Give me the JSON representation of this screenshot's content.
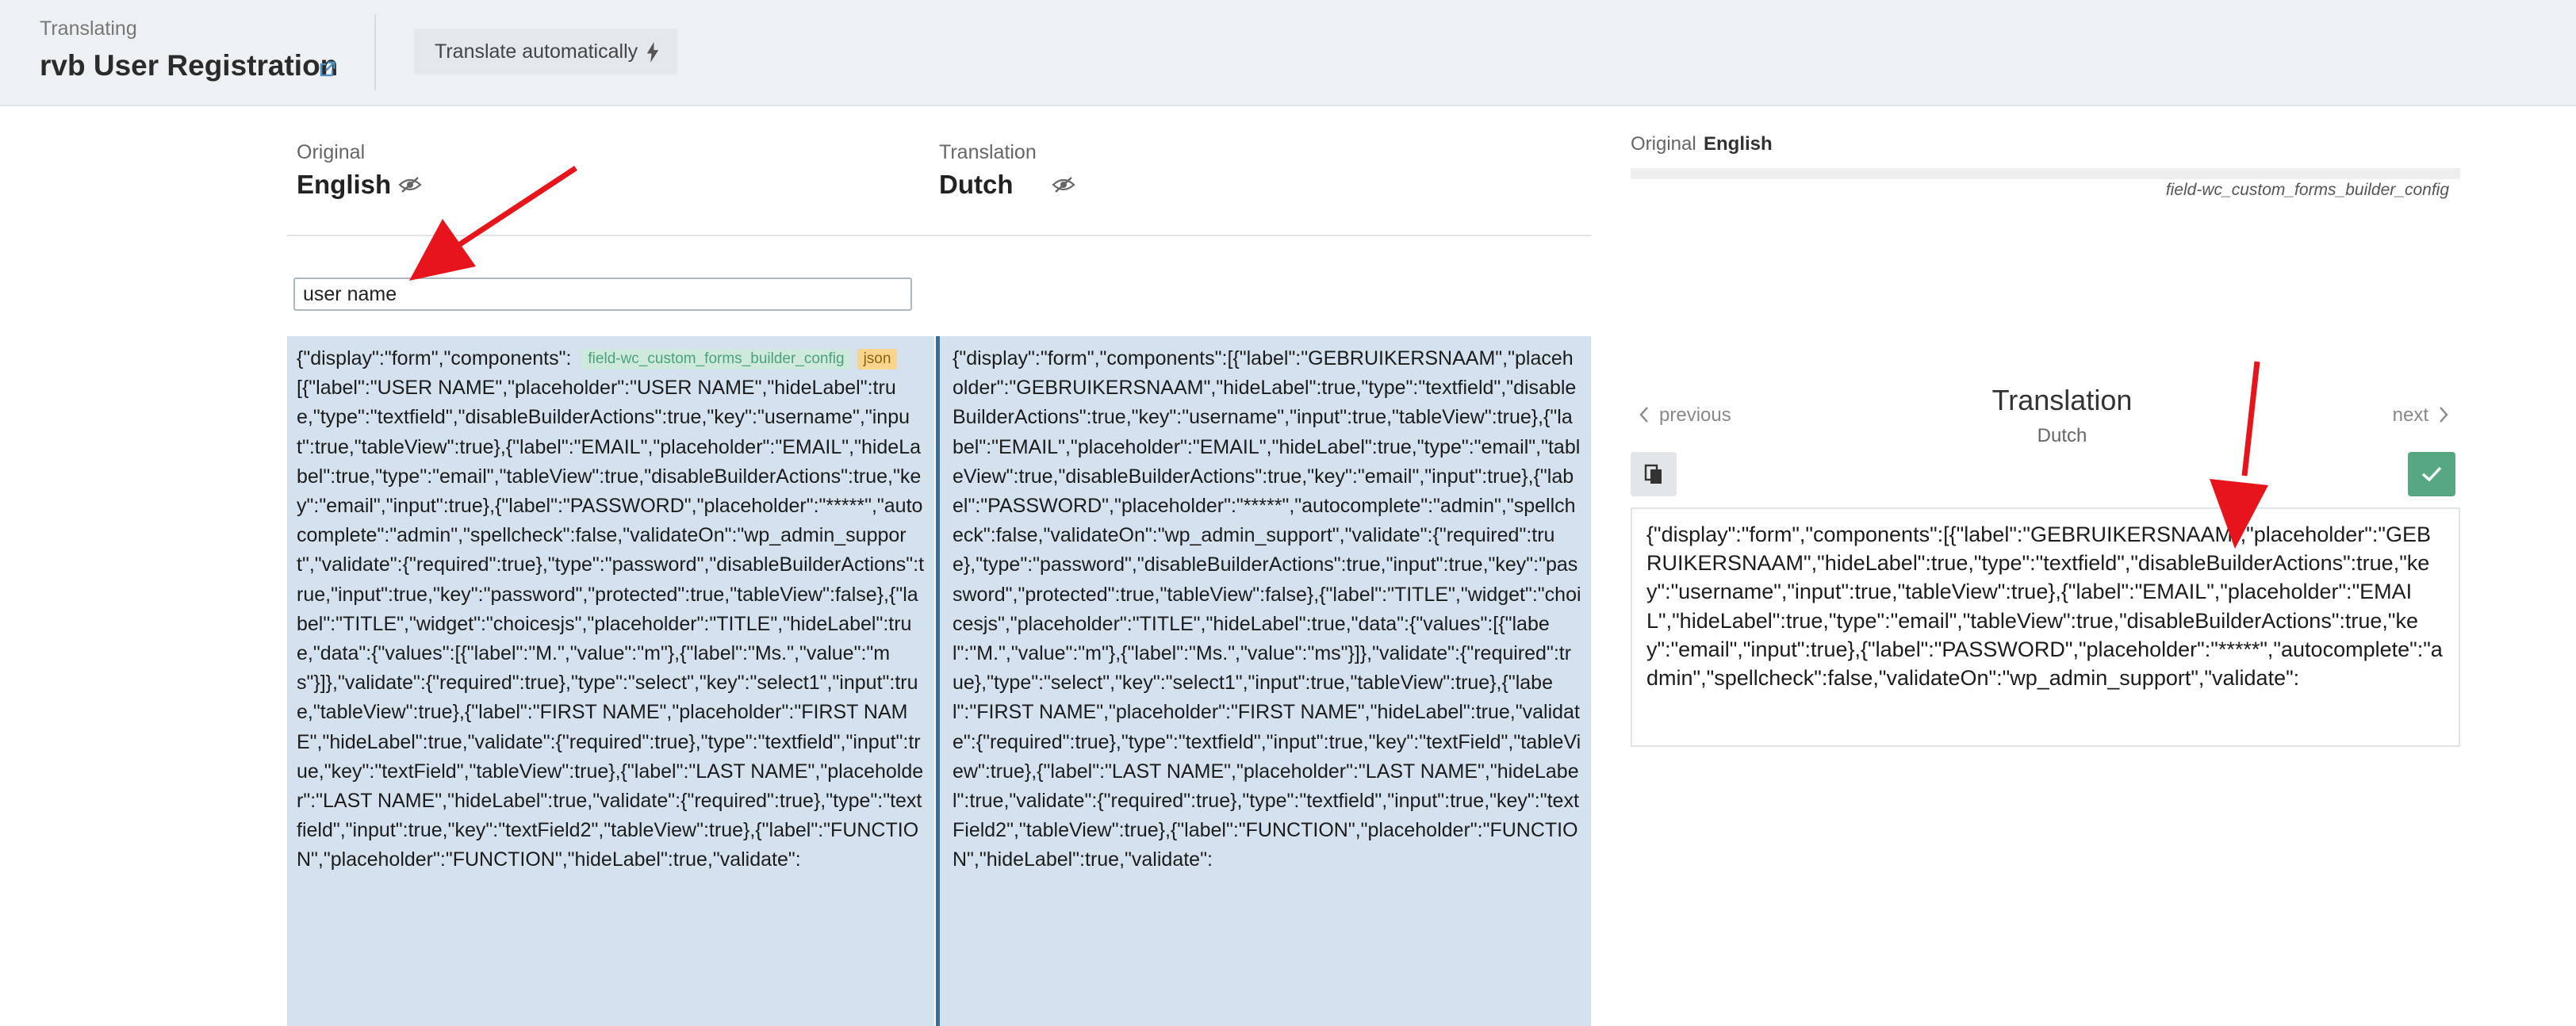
{
  "header": {
    "context_label": "Translating",
    "title": "rvb User Registration",
    "auto_translate_label": "Translate automatically"
  },
  "panes": {
    "original": {
      "caption": "Original",
      "language": "English"
    },
    "translation": {
      "caption": "Translation",
      "language": "Dutch"
    }
  },
  "search": {
    "value": "user name"
  },
  "original_text": {
    "first_line": "{\"display\":\"form\",\"components\":",
    "tags": {
      "field": "field-wc_custom_forms_builder_config",
      "format": "json"
    },
    "body": "[{\"label\":\"USER NAME\",\"placeholder\":\"USER NAME\",\"hideLabel\":true,\"type\":\"textfield\",\"disableBuilderActions\":true,\"key\":\"username\",\"input\":true,\"tableView\":true},{\"label\":\"EMAIL\",\"placeholder\":\"EMAIL\",\"hideLabel\":true,\"type\":\"email\",\"tableView\":true,\"disableBuilderActions\":true,\"key\":\"email\",\"input\":true},{\"label\":\"PASSWORD\",\"placeholder\":\"*****\",\"autocomplete\":\"admin\",\"spellcheck\":false,\"validateOn\":\"wp_admin_support\",\"validate\":{\"required\":true},\"type\":\"password\",\"disableBuilderActions\":true,\"input\":true,\"key\":\"password\",\"protected\":true,\"tableView\":false},{\"label\":\"TITLE\",\"widget\":\"choicesjs\",\"placeholder\":\"TITLE\",\"hideLabel\":true,\"data\":{\"values\":[{\"label\":\"M.\",\"value\":\"m\"},{\"label\":\"Ms.\",\"value\":\"ms\"}]},\"validate\":{\"required\":true},\"type\":\"select\",\"key\":\"select1\",\"input\":true,\"tableView\":true},{\"label\":\"FIRST NAME\",\"placeholder\":\"FIRST NAME\",\"hideLabel\":true,\"validate\":{\"required\":true},\"type\":\"textfield\",\"input\":true,\"key\":\"textField\",\"tableView\":true},{\"label\":\"LAST NAME\",\"placeholder\":\"LAST NAME\",\"hideLabel\":true,\"validate\":{\"required\":true},\"type\":\"textfield\",\"input\":true,\"key\":\"textField2\",\"tableView\":true},{\"label\":\"FUNCTION\",\"placeholder\":\"FUNCTION\",\"hideLabel\":true,\"validate\":"
  },
  "translation_text": "{\"display\":\"form\",\"components\":[{\"label\":\"GEBRUIKERSNAAM\",\"placeholder\":\"GEBRUIKERSNAAM\",\"hideLabel\":true,\"type\":\"textfield\",\"disableBuilderActions\":true,\"key\":\"username\",\"input\":true,\"tableView\":true},{\"label\":\"EMAIL\",\"placeholder\":\"EMAIL\",\"hideLabel\":true,\"type\":\"email\",\"tableView\":true,\"disableBuilderActions\":true,\"key\":\"email\",\"input\":true},{\"label\":\"PASSWORD\",\"placeholder\":\"*****\",\"autocomplete\":\"admin\",\"spellcheck\":false,\"validateOn\":\"wp_admin_support\",\"validate\":{\"required\":true},\"type\":\"password\",\"disableBuilderActions\":true,\"input\":true,\"key\":\"password\",\"protected\":true,\"tableView\":false},{\"label\":\"TITLE\",\"widget\":\"choicesjs\",\"placeholder\":\"TITLE\",\"hideLabel\":true,\"data\":{\"values\":[{\"label\":\"M.\",\"value\":\"m\"},{\"label\":\"Ms.\",\"value\":\"ms\"}]},\"validate\":{\"required\":true},\"type\":\"select\",\"key\":\"select1\",\"input\":true,\"tableView\":true},{\"label\":\"FIRST NAME\",\"placeholder\":\"FIRST NAME\",\"hideLabel\":true,\"validate\":{\"required\":true},\"type\":\"textfield\",\"input\":true,\"key\":\"textField\",\"tableView\":true},{\"label\":\"LAST NAME\",\"placeholder\":\"LAST NAME\",\"hideLabel\":true,\"validate\":{\"required\":true},\"type\":\"textfield\",\"input\":true,\"key\":\"textField2\",\"tableView\":true},{\"label\":\"FUNCTION\",\"placeholder\":\"FUNCTION\",\"hideLabel\":true,\"validate\":",
  "right_panel": {
    "original_caption": "Original",
    "original_language": "English",
    "field_key": "field-wc_custom_forms_builder_config",
    "prev_label": "previous",
    "next_label": "next",
    "title": "Translation",
    "subtitle": "Dutch",
    "editor_text": "{\"display\":\"form\",\"components\":[{\"label\":\"GEBRUIKERSNAAM\",\"placeholder\":\"GEBRUIKERSNAAM\",\"hideLabel\":true,\"type\":\"textfield\",\"disableBuilderActions\":true,\"key\":\"username\",\"input\":true,\"tableView\":true},{\"label\":\"EMAIL\",\"placeholder\":\"EMAIL\",\"hideLabel\":true,\"type\":\"email\",\"tableView\":true,\"disableBuilderActions\":true,\"key\":\"email\",\"input\":true},{\"label\":\"PASSWORD\",\"placeholder\":\"*****\",\"autocomplete\":\"admin\",\"spellcheck\":false,\"validateOn\":\"wp_admin_support\",\"validate\":"
  },
  "icons": {
    "external_link": "external-link-icon",
    "bolt": "bolt-icon",
    "visibility": "eye-slash-icon",
    "copy": "copy-icon",
    "save": "check-icon",
    "prev": "chevron-left-icon",
    "next": "chevron-right-icon"
  },
  "colors": {
    "accent_blue": "#3c6d97",
    "column_bg": "#d4e2ef",
    "save_green": "#57a882",
    "annotation_red": "#e8141b"
  }
}
